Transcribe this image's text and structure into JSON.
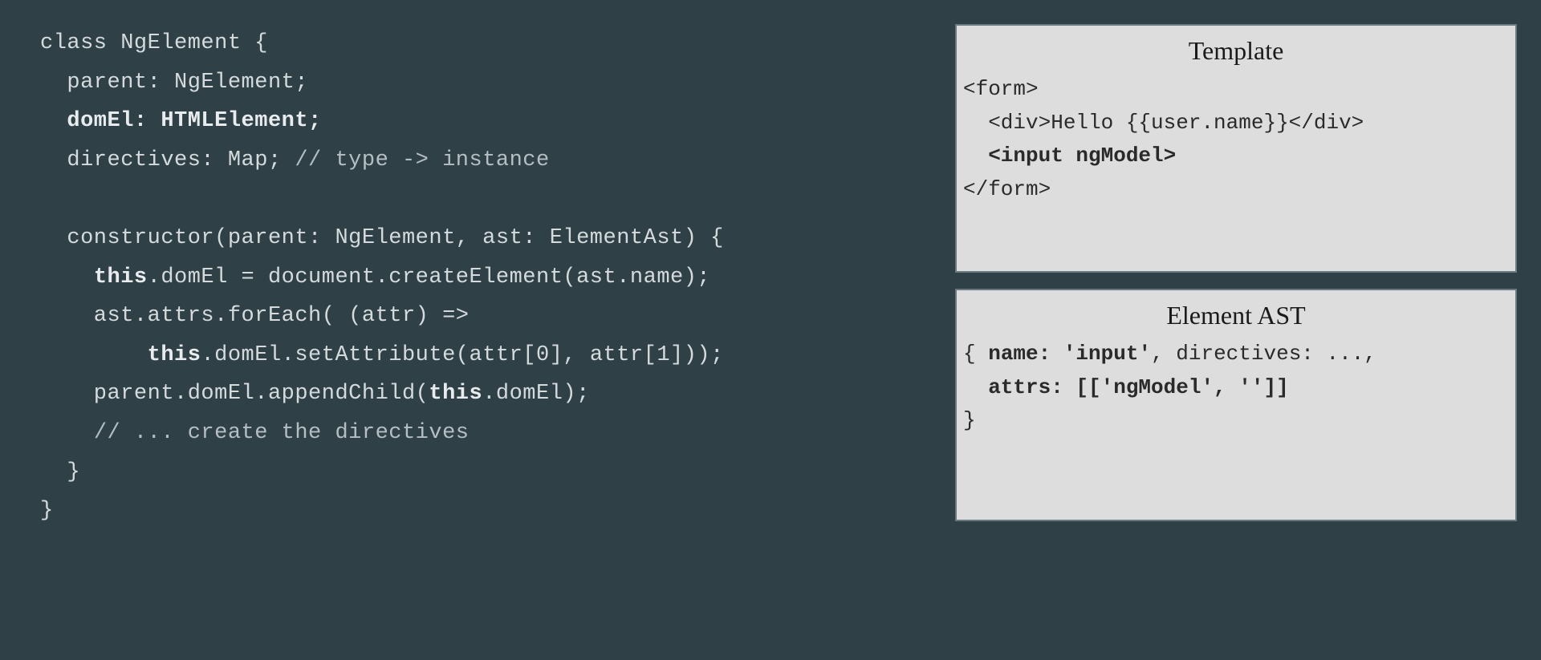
{
  "code": {
    "line01a": "class NgElement {",
    "line02a": "  parent: NgElement;",
    "line03b": "  domEl: HTMLElement;",
    "line04a": "  directives: Map; ",
    "line04c": "// type -> instance",
    "line05a": "",
    "line06a": "  constructor(parent: NgElement, ast: ElementAst) {",
    "line07a": "    ",
    "line07b": "this",
    "line07c": ".domEl = document.createElement(ast.name);",
    "line08a": "    ast.attrs.forEach( (attr) =>",
    "line09a": "        ",
    "line09b": "this",
    "line09c": ".domEl.setAttribute(attr[0], attr[1]));",
    "line10a": "    parent.domEl.appendChild(",
    "line10b": "this",
    "line10c": ".domEl);",
    "line11a": "    ",
    "line11c": "// ... create the directives",
    "line12a": "  }",
    "line13a": "}"
  },
  "panel_template": {
    "title": "Template",
    "l1": "<form>",
    "l2": "  <div>Hello {{user.name}}</div>",
    "l3": "  <input ngModel>",
    "l4": "</form>"
  },
  "panel_ast": {
    "title": "Element AST",
    "l1a": "{ ",
    "l1b": "name: 'input'",
    "l1c": ", directives: ...,",
    "l2b": "  attrs: [['ngModel', '']]",
    "l3": "}"
  }
}
